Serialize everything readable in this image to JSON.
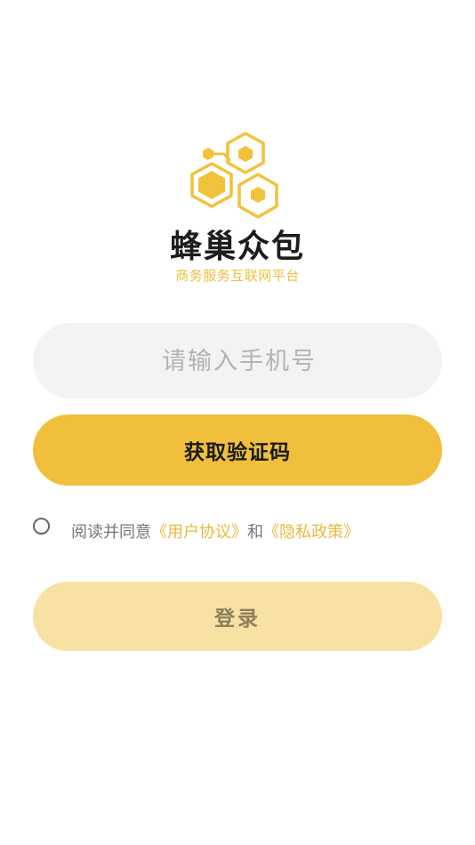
{
  "brand": {
    "logo_icon": "honeycomb-icon",
    "name": "蜂巢众包",
    "slogan": "商务服务互联网平台"
  },
  "login_form": {
    "phone_placeholder": "请输入手机号",
    "phone_value": "",
    "get_code_label": "获取验证码",
    "agreement": {
      "checked": false,
      "prefix": "阅读并同意",
      "user_agreement_link": "《用户协议》",
      "connector": "和",
      "privacy_policy_link": "《隐私政策》"
    },
    "login_label": "登录"
  },
  "colors": {
    "accent": "#f0bf3b",
    "accent_disabled": "#f7e2a4",
    "link": "#e9b93c",
    "input_bg": "#f3f3f3"
  }
}
